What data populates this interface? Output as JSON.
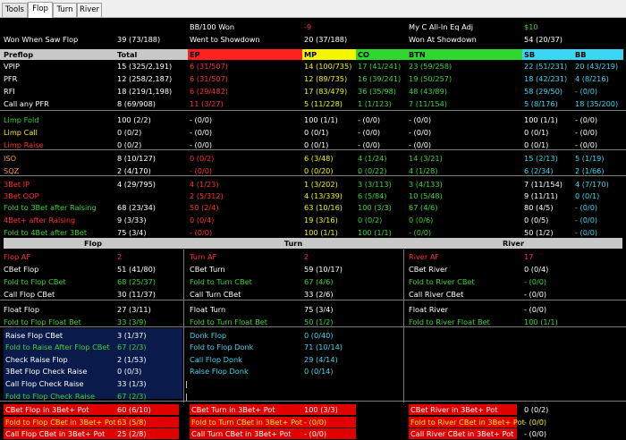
{
  "tabs": [
    "Tools",
    "Flop",
    "Turn",
    "River"
  ],
  "summary": {
    "row1": [
      {
        "label": "BB/100 Won",
        "value": "-9"
      },
      {
        "label": "My C All-In Eq Adj",
        "value": "$10"
      }
    ],
    "row2": [
      {
        "label": "Won When Saw Flop",
        "value": "39 (73/188)"
      },
      {
        "label": "Went to Showdown",
        "value": "20 (37/188)"
      },
      {
        "label": "Won At Showdown",
        "value": "54 (20/37)"
      }
    ]
  },
  "preflop": {
    "headers": [
      "Preflop",
      "Total",
      "EP",
      "MP",
      "CO",
      "BTN",
      "SB",
      "BB"
    ],
    "header_colors": [
      "#c8c8c8",
      "#c8c8c8",
      "#ff2020",
      "#f5f500",
      "#2ed82e",
      "#2ed82e",
      "#3ad7f2",
      "#3ad7f2"
    ],
    "rows": [
      {
        "label": "VPIP",
        "values": [
          "15 (325/2,191)",
          "6 (31/507)",
          "14 (100/735)",
          "17 (41/241)",
          "23 (59/258)",
          "22 (51/231)",
          "20 (43/219)"
        ]
      },
      {
        "label": "PFR",
        "values": [
          "12 (258/2,187)",
          "6 (31/507)",
          "12 (89/735)",
          "16 (39/241)",
          "19 (50/257)",
          "18 (42/231)",
          "4 (8/216)"
        ]
      },
      {
        "label": "RFI",
        "values": [
          "18 (219/1,198)",
          "6 (29/482)",
          "17 (83/479)",
          "36 (35/98)",
          "48 (43/89)",
          "58 (29/50)",
          "- (0/0)"
        ]
      },
      {
        "label": "Call any PFR",
        "values": [
          "8 (69/908)",
          "11 (3/27)",
          "5 (11/228)",
          "1 (1/123)",
          "7 (11/154)",
          "5 (8/176)",
          "18 (35/200)"
        ]
      }
    ],
    "limp_rows": [
      {
        "label": "Limp Fold",
        "values": [
          "100 (2/2)",
          "- (0/0)",
          "100 (1/1)",
          "- (0/0)",
          "- (0/0)",
          "100 (1/1)",
          "- (0/0)"
        ]
      },
      {
        "label": "Limp Call",
        "values": [
          "0 (0/2)",
          "- (0/0)",
          "0 (0/1)",
          "- (0/0)",
          "- (0/0)",
          "0 (0/1)",
          "- (0/0)"
        ]
      },
      {
        "label": "Limp Raise",
        "values": [
          "0 (0/2)",
          "- (0/0)",
          "0 (0/1)",
          "- (0/0)",
          "- (0/0)",
          "0 (0/1)",
          "- (0/0)"
        ]
      }
    ],
    "iso_rows": [
      {
        "label": "ISO",
        "values": [
          "8 (10/127)",
          "0 (0/2)",
          "6 (3/48)",
          "4 (1/24)",
          "14 (3/21)",
          "15 (2/13)",
          "5 (1/19)"
        ]
      },
      {
        "label": "SQZ",
        "values": [
          "2 (4/170)",
          "- (0/0)",
          "0 (0/20)",
          "0 (0/22)",
          "4 (1/28)",
          "6 (2/34)",
          "2 (1/66)"
        ]
      }
    ],
    "threebet_rows": [
      {
        "label": "3Bet IP",
        "values": [
          "4 (29/795)",
          "4 (1/23)",
          "1 (3/202)",
          "3 (3/113)",
          "3 (4/133)",
          "7 (11/154)",
          "4 (7/170)"
        ]
      },
      {
        "label": "3Bet OOP",
        "values": [
          "",
          "2 (5/312)",
          "4 (13/339)",
          "6 (5/84)",
          "10 (5/48)",
          "9 (11/11)",
          "0 (0/1)"
        ]
      },
      {
        "label": "Fold to 3Bet after Raising",
        "values": [
          "68 (23/34)",
          "50 (2/4)",
          "63 (10/16)",
          "100 (3/3)",
          "67 (4/6)",
          "80 (4/5)",
          "- (0/0)"
        ]
      },
      {
        "label": "4Bet+ after Raising",
        "values": [
          "9 (3/33)",
          "0 (0/4)",
          "19 (3/16)",
          "0 (0/2)",
          "0 (0/6)",
          "0 (0/5)",
          "- (0/0)"
        ]
      },
      {
        "label": "Fold to 4Bet after 3Bet",
        "values": [
          "75 (3/4)",
          "- (0/0)",
          "100 (1/1)",
          "100 (1/1)",
          "- (0/0)",
          "50 (1/2)",
          "- (0/0)"
        ]
      }
    ]
  },
  "postflop": {
    "headers": [
      "Flop",
      "Turn",
      "River"
    ],
    "af": [
      {
        "label": "Flop AF",
        "value": "2"
      },
      {
        "label": "Turn AF",
        "value": "2"
      },
      {
        "label": "River AF",
        "value": "17"
      }
    ],
    "cbet": [
      [
        {
          "label": "CBet Flop",
          "value": "51 (41/80)"
        },
        {
          "label": "CBet Turn",
          "value": "59 (10/17)"
        },
        {
          "label": "CBet River",
          "value": "0 (0/4)"
        }
      ],
      [
        {
          "label": "Fold to Flop CBet",
          "value": "68 (25/37)"
        },
        {
          "label": "Fold to Turn CBet",
          "value": "67 (4/6)"
        },
        {
          "label": "Fold to River CBet",
          "value": "- (0/0)"
        }
      ],
      [
        {
          "label": "Call Flop CBet",
          "value": "30 (11/37)"
        },
        {
          "label": "Call Turn CBet",
          "value": "33 (2/6)"
        },
        {
          "label": "Call River CBet",
          "value": "- (0/0)"
        }
      ]
    ],
    "float": [
      [
        {
          "label": "Float Flop",
          "value": "27 (3/11)"
        },
        {
          "label": "Float Turn",
          "value": "75 (3/4)"
        },
        {
          "label": "Float River",
          "value": "- (0/0)"
        }
      ],
      [
        {
          "label": "Fold to Flop Float Bet",
          "value": "33 (3/9)"
        },
        {
          "label": "Fold to Turn Float Bet",
          "value": "50 (1/2)"
        },
        {
          "label": "Fold to River Float Bet",
          "value": "100 (1/1)"
        }
      ]
    ],
    "raise_flop": [
      {
        "label": "Raise Flop CBet",
        "value": "3 (1/37)"
      },
      {
        "label": "Fold to Raise After Flop CBet",
        "value": "67 (2/3)"
      },
      {
        "label": "Check Raise Flop",
        "value": "2 (1/53)"
      },
      {
        "label": "3Bet Flop Check Raise",
        "value": "0 (0/3)"
      },
      {
        "label": "Call Flop Check Raise",
        "value": "33 (1/3)"
      },
      {
        "label": "Fold to Flop Check Raise",
        "value": "67 (2/3)"
      }
    ],
    "donk": [
      {
        "label": "Donk Flop",
        "value": "0 (0/40)"
      },
      {
        "label": "Fold to Flop Donk",
        "value": "71 (10/14)"
      },
      {
        "label": "Call Flop Donk",
        "value": "29 (4/14)"
      },
      {
        "label": "Raise Flop Donk",
        "value": "0 (0/14)"
      }
    ],
    "threebet_pot": [
      [
        {
          "label": "CBet Flop in 3Bet+ Pot",
          "value": "60 (6/10)"
        },
        {
          "label": "CBet Turn in 3Bet+ Pot",
          "value": "100 (3/3)"
        },
        {
          "label": "CBet River in 3Bet+ Pot",
          "value": "0 (0/2)"
        }
      ],
      [
        {
          "label": "Fold to Flop CBet in 3Bet+ Pot",
          "value": "63 (5/8)"
        },
        {
          "label": "Fold to Turn CBet in 3Bet+ Pot",
          "value": "- (0/0)"
        },
        {
          "label": "Fold to River CBet in 3Bet+ Pot",
          "value": "- (0/0)"
        }
      ],
      [
        {
          "label": "Call Flop CBet in 3Bet+ Pot",
          "value": "25 (2/8)"
        },
        {
          "label": "Call Turn CBet in 3Bet+ Pot",
          "value": "- (0/0)"
        },
        {
          "label": "Call River CBet in 3Bet+ Pot",
          "value": "- (0/0)"
        }
      ]
    ]
  }
}
